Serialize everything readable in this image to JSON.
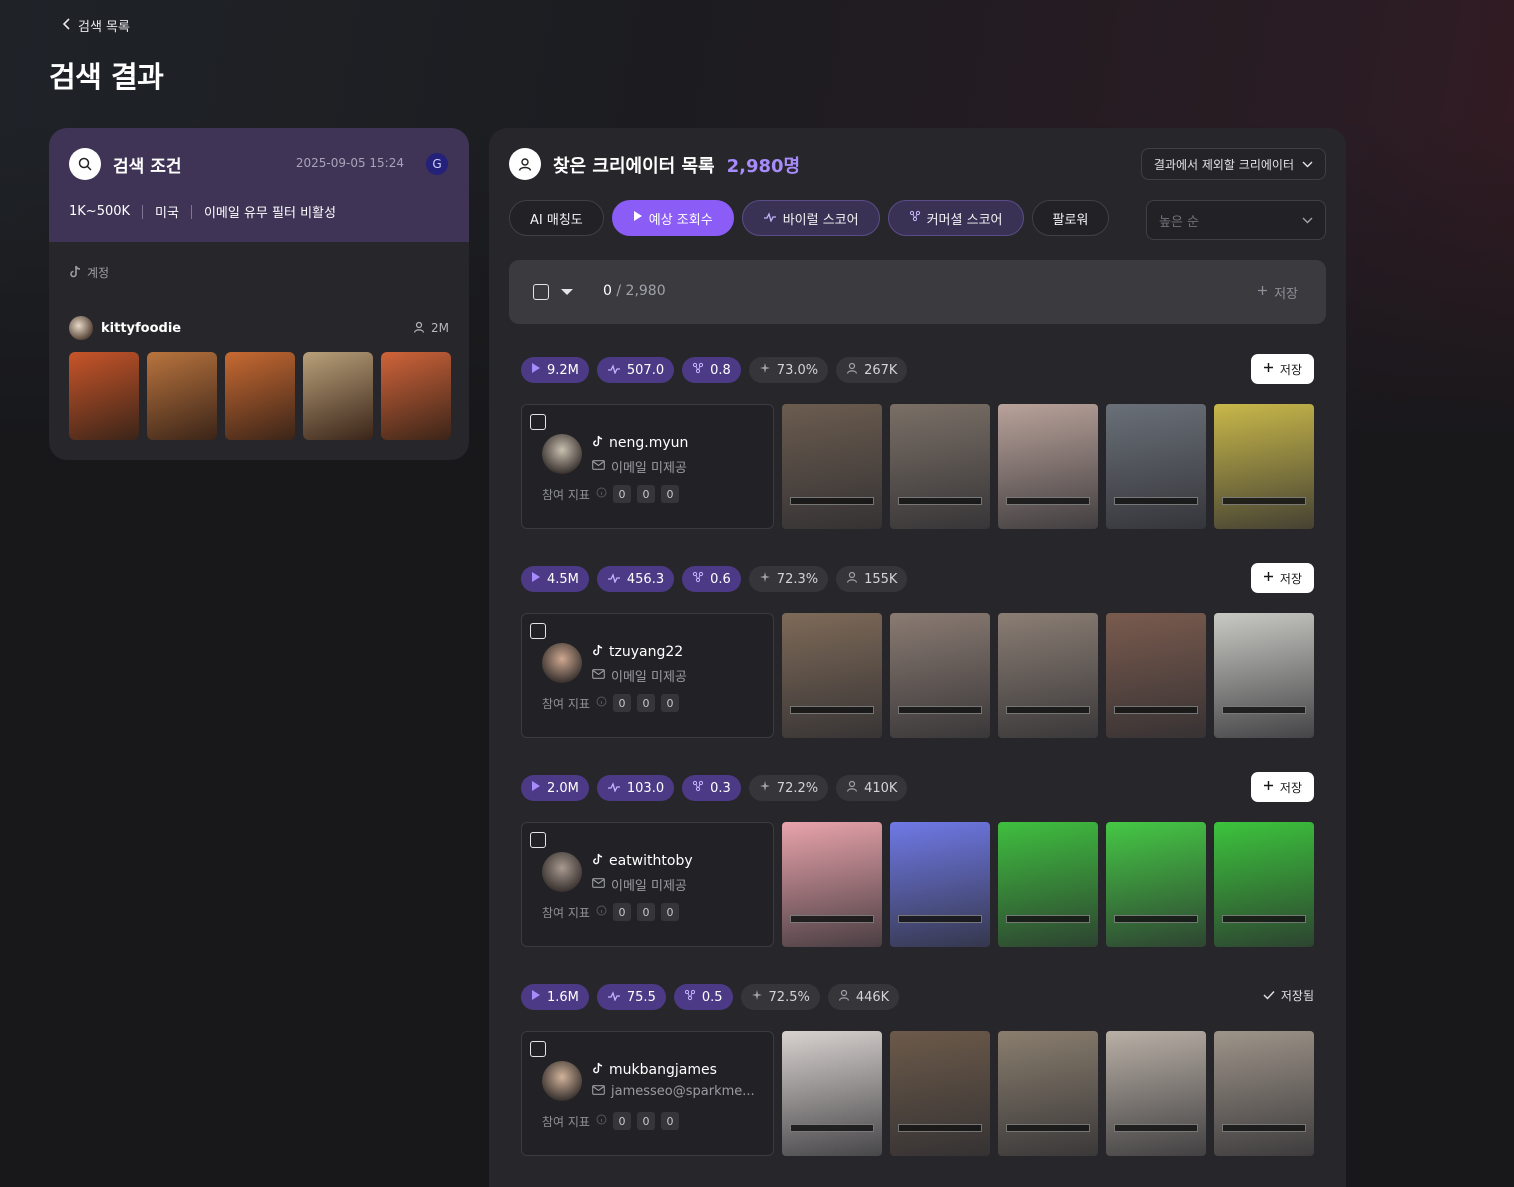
{
  "nav": {
    "back_label": "검색 목록"
  },
  "page": {
    "title": "검색 결과"
  },
  "conditions": {
    "title": "검색 조건",
    "date": "2025-09-05 15:24",
    "badge": "G",
    "filters": [
      "1K~500K",
      "미국",
      "이메일 유무 필터 비활성"
    ],
    "account_label": "계정",
    "account": {
      "name": "kittyfoodie",
      "followers": "2M"
    }
  },
  "results": {
    "title": "찾은 크리에이터 목록",
    "count": "2,980명",
    "exclude_label": "결과에서 제외할 크리에이터",
    "tabs": [
      {
        "label": "AI 매칭도",
        "state": "default"
      },
      {
        "label": "예상 조회수",
        "state": "active"
      },
      {
        "label": "바이럴 스코어",
        "state": "accent"
      },
      {
        "label": "커머셜 스코어",
        "state": "accent"
      },
      {
        "label": "팔로워",
        "state": "default"
      }
    ],
    "sort_placeholder": "높은 순",
    "selected": "0",
    "total": "/ 2,980",
    "bulk_save_label": "저장",
    "engagement_label": "참여 지표",
    "creators": [
      {
        "views": "9.2M",
        "viral": "507.0",
        "commercial": "0.8",
        "match": "73.0%",
        "followers": "267K",
        "handle": "neng.myun",
        "email": "이메일 미제공",
        "engagement": [
          "0",
          "0",
          "0"
        ],
        "action": "저장",
        "saved": false,
        "thumb_colors": [
          "#6b5c4f",
          "#7a6f66",
          "#b9a29a",
          "#6a7078",
          "#c9b84a"
        ]
      },
      {
        "views": "4.5M",
        "viral": "456.3",
        "commercial": "0.6",
        "match": "72.3%",
        "followers": "155K",
        "handle": "tzuyang22",
        "email": "이메일 미제공",
        "engagement": [
          "0",
          "0",
          "0"
        ],
        "action": "저장",
        "saved": false,
        "thumb_colors": [
          "#7e6a58",
          "#8a7b72",
          "#8b7e74",
          "#7a5b4e",
          "#c9c9c4"
        ]
      },
      {
        "views": "2.0M",
        "viral": "103.0",
        "commercial": "0.3",
        "match": "72.2%",
        "followers": "410K",
        "handle": "eatwithtoby",
        "email": "이메일 미제공",
        "engagement": [
          "0",
          "0",
          "0"
        ],
        "action": "저장",
        "saved": false,
        "thumb_colors": [
          "#e9a3ab",
          "#6f79e6",
          "#3fbf3f",
          "#45c845",
          "#3cc43c"
        ]
      },
      {
        "views": "1.6M",
        "viral": "75.5",
        "commercial": "0.5",
        "match": "72.5%",
        "followers": "446K",
        "handle": "mukbangjames",
        "email": "jamesseo@sparkme...",
        "engagement": [
          "0",
          "0",
          "0"
        ],
        "action": "저장됨",
        "saved": true,
        "thumb_colors": [
          "#d8d2cf",
          "#6c5a4a",
          "#8a7e6e",
          "#b9b0a6",
          "#9e9489"
        ]
      }
    ]
  },
  "left_thumb_colors": [
    "#c8552a",
    "#b9743e",
    "#c86a32",
    "#b8a07a",
    "#d0643a"
  ],
  "creator_avatar_colors": [
    "#c9c0b0",
    "#cfa890",
    "#a89a90",
    "#d2b39a"
  ]
}
